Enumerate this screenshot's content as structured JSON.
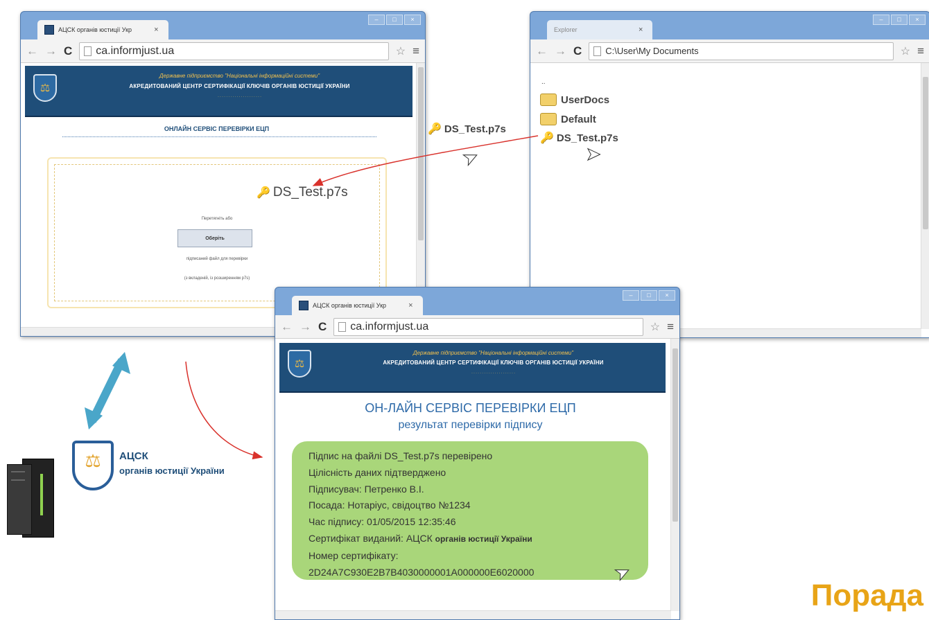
{
  "browser_main": {
    "tab_title": "АЦСК органів юстиції Укр",
    "url": "ca.informjust.ua",
    "banner_line1": "Державне підприємство \"Національні інформаційні системи\"",
    "banner_line2": "АКРЕДИТОВАНИЙ ЦЕНТР СЕРТИФІКАЦІЇ КЛЮЧІВ ОРГАНІВ ЮСТИЦІЇ УКРАЇНИ",
    "heading": "ОНЛАЙН СЕРВІС ПЕРЕВІРКИ ЕЦП",
    "drop_hint": "Перетягніть або",
    "choose_button": "Оберіть",
    "signed_file_hint": "підписаний файл для перевірки",
    "extension_hint": "(з вкладеній, із розширенням р7s)",
    "dropped_file": "DS_Test.p7s"
  },
  "explorer": {
    "tab_title": "Explorer",
    "path": "C:\\User\\My Documents",
    "parent_dir": "..",
    "items": [
      {
        "name": "UserDocs",
        "icon": "folder-icon"
      },
      {
        "name": "Default",
        "icon": "folder-icon"
      },
      {
        "name": "DS_Test.p7s",
        "icon": "key-file-icon"
      }
    ]
  },
  "dragging_file": "DS_Test.p7s",
  "browser_result": {
    "tab_title": "АЦСК органів юстиції Укр",
    "url": "ca.informjust.ua",
    "banner_line1": "Державне підприємство \"Національні інформаційні системи\"",
    "banner_line2": "АКРЕДИТОВАНИЙ ЦЕНТР СЕРТИФІКАЦІЇ КЛЮЧІВ ОРГАНІВ ЮСТИЦІЇ УКРАЇНИ",
    "heading": "ОН-ЛАЙН СЕРВІС ПЕРЕВІРКИ ЕЦП",
    "subheading": "результат перевірки підпису",
    "result_lines": [
      "Підпис на файлі DS_Test.p7s перевірено",
      "Цілісність даних підтверджено",
      "Підписувач: Петренко В.І.",
      "Посада: Нотаріус, свідоцтво №1234",
      "Час підпису: 01/05/2015 12:35:46"
    ],
    "issuer_prefix": "Сертифікат виданий: АЦСК",
    "issuer_bold": "органів юстиції України",
    "cert_label": "Номер сертифікату:",
    "cert_number": "2D24A7C930E2B7B4030000001A000000E6020000"
  },
  "acsk_logo": {
    "line1": "АЦСК",
    "line2": "органів юстиції України"
  },
  "corner_label": "Порада",
  "colors": {
    "banner": "#1f4e79",
    "result_box": "#a9d67a",
    "corner_label": "#e8a417",
    "drag_arrow": "#d9322c",
    "sync_arrow": "#4aa6c9"
  }
}
